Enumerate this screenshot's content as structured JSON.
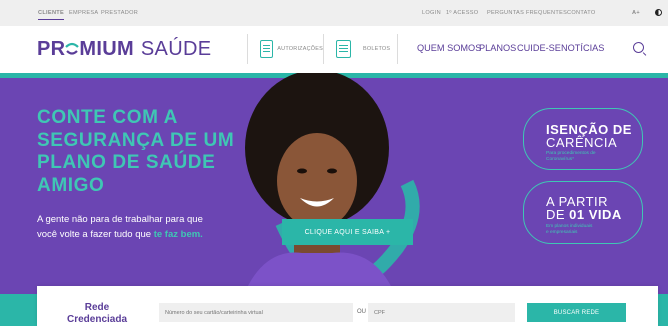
{
  "topbar": {
    "audiences": [
      "CLIENTE",
      "EMPRESA",
      "PRESTADOR"
    ],
    "links": [
      "LOGIN",
      "1º ACESSO",
      "PERGUNTAS FREQUENTES",
      "CONTATO"
    ],
    "font_size": "A+"
  },
  "header": {
    "logo_part1": "PR",
    "logo_part2": "MIUM",
    "logo_part3": "SAÚDE",
    "buttons": [
      "AUTORIZAÇÕES",
      "BOLETOS"
    ],
    "nav": [
      "QUEM SOMOS",
      "PLANOS",
      "CUIDE-SE",
      "NOTÍCIAS"
    ]
  },
  "hero": {
    "headline": [
      "CONTE COM A",
      "SEGURANÇA DE UM",
      "PLANO DE SAÚDE",
      "AMIGO"
    ],
    "subline1": "A gente não para de trabalhar para que",
    "subline2": "você volte a fazer tudo que",
    "subline_highlight": "te faz bem.",
    "cta": "CLIQUE AQUI E SAIBA +",
    "badge1": {
      "line1": "ISENÇÃO DE",
      "line2": "CARÊNCIA",
      "small1": "Para procedimentos de",
      "small2": "Coronavírus*"
    },
    "badge2": {
      "line1": "A PARTIR",
      "line2a": "DE ",
      "line2b": "01 VIDA",
      "small1": "Em planos individuais",
      "small2": "e empresariais"
    }
  },
  "search": {
    "title_line1": "Rede",
    "title_line2": "Credenciada",
    "card_placeholder": "Número do seu cartão/carteirinha virtual",
    "or": "OU",
    "cpf_placeholder": "CPF",
    "button": "BUSCAR REDE"
  },
  "colors": {
    "purple": "#6b45b3",
    "teal": "#2bb6a8",
    "brand": "#5a3d98"
  }
}
